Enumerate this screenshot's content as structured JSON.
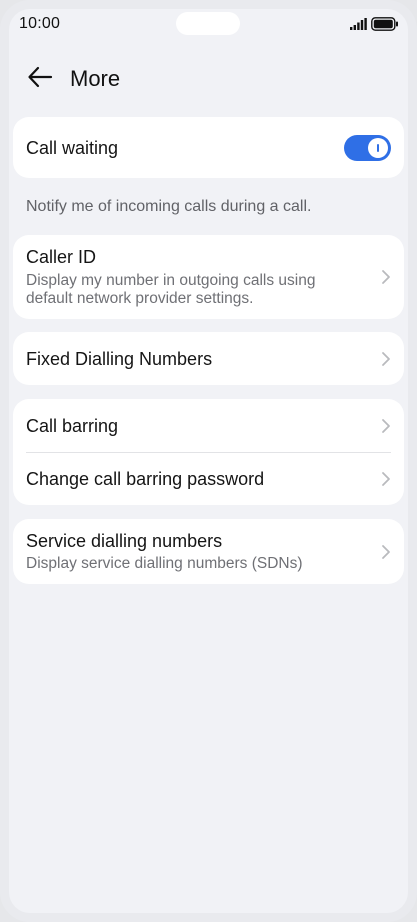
{
  "status_bar": {
    "time": "10:00",
    "signal_icon": "signal-icon",
    "battery_icon": "battery-icon"
  },
  "header": {
    "back_icon": "arrow-left-icon",
    "title": "More"
  },
  "call_waiting": {
    "label": "Call waiting",
    "toggle_on": true,
    "description": "Notify me of incoming calls during a call."
  },
  "caller_id": {
    "title": "Caller ID",
    "subtitle_line1": "Display my number in outgoing calls using",
    "subtitle_line2": "default network provider settings."
  },
  "fixed_dialling": {
    "title": "Fixed Dialling Numbers"
  },
  "call_barring": {
    "title": "Call barring",
    "password_title": "Change call barring password"
  },
  "service_dialling": {
    "title": "Service dialling numbers",
    "subtitle": "Display service dialling numbers (SDNs)"
  },
  "colors": {
    "accent": "#2f6fe6",
    "background": "#f1f2f6",
    "card": "#ffffff",
    "secondary_text": "#6f7075"
  }
}
